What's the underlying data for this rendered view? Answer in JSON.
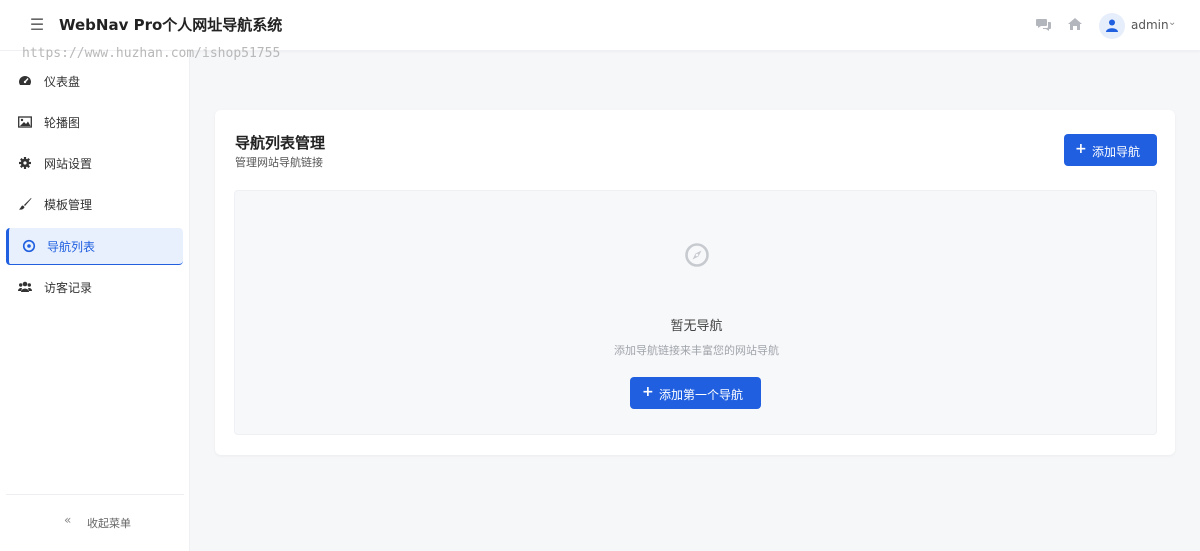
{
  "header": {
    "brand": "WebNav Pro个人网址导航系统",
    "watermark": "https://www.huzhan.com/ishop51755",
    "username": "admin",
    "icons": [
      "menu-icon",
      "chat-icon",
      "home-icon",
      "user-icon",
      "chevron-down-icon"
    ]
  },
  "sidebar": {
    "items": [
      {
        "label": "仪表盘",
        "icon": "dashboard-icon"
      },
      {
        "label": "轮播图",
        "icon": "image-icon"
      },
      {
        "label": "网站设置",
        "icon": "gear-icon"
      },
      {
        "label": "模板管理",
        "icon": "brush-icon"
      },
      {
        "label": "导航列表",
        "icon": "compass-icon",
        "active": true
      },
      {
        "label": "访客记录",
        "icon": "users-icon"
      }
    ],
    "collapse_label": "收起菜单",
    "collapse_glyph": "«"
  },
  "main": {
    "title": "导航列表管理",
    "subtitle": "管理网站导航链接",
    "add_button": "添加导航",
    "empty": {
      "title": "暂无导航",
      "description": "添加导航链接来丰富您的网站导航",
      "button": "添加第一个导航"
    }
  },
  "colors": {
    "primary": "#1f5fe0",
    "active_bg": "#e9f0fd",
    "page_bg": "#f6f7f9"
  }
}
